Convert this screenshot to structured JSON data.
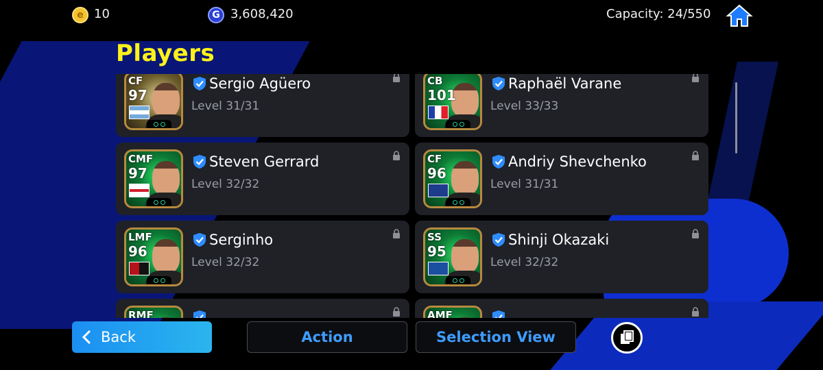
{
  "header": {
    "efootball_coins": "10",
    "gp": "3,608,420",
    "capacity_label": "Capacity: 24/550",
    "coin_e_glyph": "e",
    "coin_g_glyph": "G"
  },
  "page_title": "Players",
  "players": [
    {
      "position": "CF",
      "rating": "97",
      "name": "Sergio Agüero",
      "level": "Level 31/31",
      "portrait": "gold"
    },
    {
      "position": "CB",
      "rating": "101",
      "name": "Raphaël Varane",
      "level": "Level 33/33",
      "portrait": "green"
    },
    {
      "position": "CMF",
      "rating": "97",
      "name": "Steven Gerrard",
      "level": "Level 32/32",
      "portrait": "green"
    },
    {
      "position": "CF",
      "rating": "96",
      "name": "Andriy Shevchenko",
      "level": "Level 31/31",
      "portrait": "green"
    },
    {
      "position": "LMF",
      "rating": "96",
      "name": "Serginho",
      "level": "Level 32/32",
      "portrait": "green"
    },
    {
      "position": "SS",
      "rating": "95",
      "name": "Shinji Okazaki",
      "level": "Level 32/32",
      "portrait": "green"
    },
    {
      "position": "RMF",
      "rating": "",
      "name": "",
      "level": "",
      "portrait": "green"
    },
    {
      "position": "AMF",
      "rating": "",
      "name": "",
      "level": "",
      "portrait": "green"
    }
  ],
  "footer": {
    "back_label": "Back",
    "action_label": "Action",
    "selection_view_label": "Selection View"
  },
  "colors": {
    "title": "#fff21a",
    "accent_blue": "#3e9cff",
    "card_bg": "#1f2127"
  }
}
